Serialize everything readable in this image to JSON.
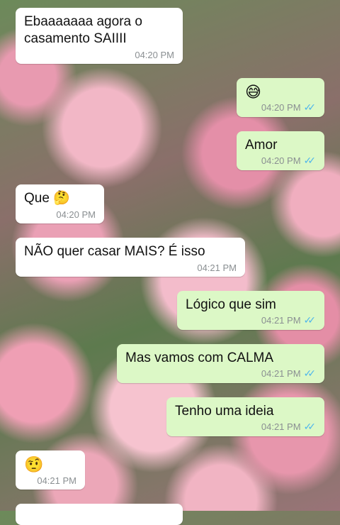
{
  "messages": [
    {
      "dir": "in",
      "text": "Ebaaaaaaa agora o\ncasamento SAIIII",
      "time": "04:20 PM"
    },
    {
      "dir": "out",
      "text": "😅",
      "time": "04:20 PM",
      "status": "read"
    },
    {
      "dir": "out",
      "text": "Amor",
      "time": "04:20 PM",
      "status": "read"
    },
    {
      "dir": "in",
      "text": "Que 🤔",
      "time": "04:20 PM"
    },
    {
      "dir": "in",
      "text": "NÃO quer casar MAIS? É isso",
      "time": "04:21 PM"
    },
    {
      "dir": "out",
      "text": "Lógico que sim",
      "time": "04:21 PM",
      "status": "read"
    },
    {
      "dir": "out",
      "text": "Mas vamos com CALMA",
      "time": "04:21 PM",
      "status": "read"
    },
    {
      "dir": "out",
      "text": "Tenho uma ideia",
      "time": "04:21 PM",
      "status": "read"
    },
    {
      "dir": "in",
      "text": "🤨",
      "time": "04:21 PM"
    }
  ],
  "icons": {
    "read_receipt": "double-check-icon"
  },
  "colors": {
    "incoming": "#ffffff",
    "outgoing": "#dcf8c6",
    "read_tick": "#4fb6ec"
  }
}
